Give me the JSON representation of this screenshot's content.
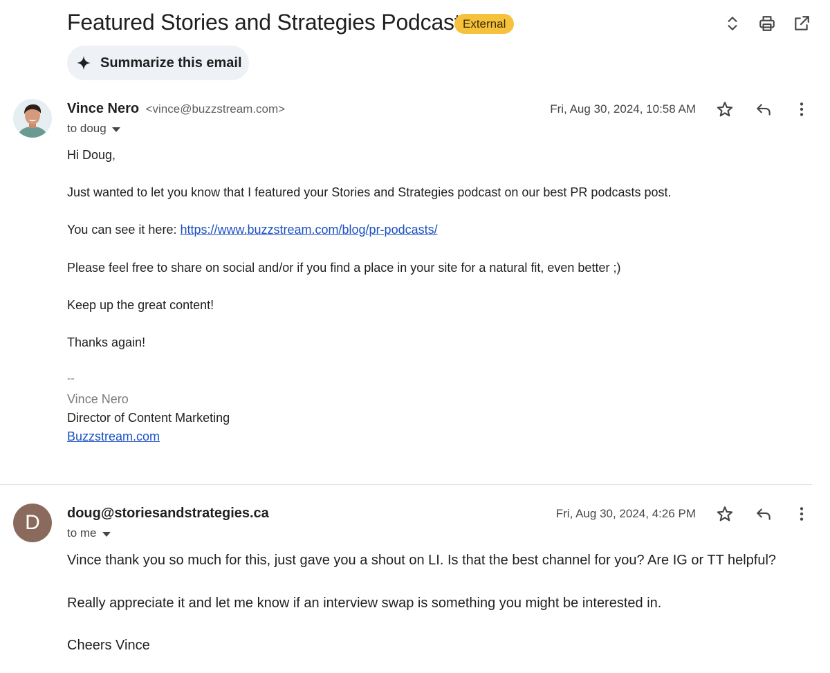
{
  "header": {
    "subject": "Featured Stories and Strategies Podcast",
    "badge": "External",
    "summarize_label": "Summarize this email",
    "icons": [
      "expand-collapse-icon",
      "print-icon",
      "open-in-new-window-icon"
    ]
  },
  "messages": [
    {
      "sender_name": "Vince Nero",
      "sender_email": "<vince@buzzstream.com>",
      "to": "to doug",
      "date": "Fri, Aug 30, 2024, 10:58 AM",
      "body": {
        "greeting": "Hi Doug,",
        "p1": "Just wanted to let you know that I featured your Stories and Strategies podcast on our best PR podcasts post.",
        "p2_prefix": "You can see it here: ",
        "p2_link": "https://www.buzzstream.com/blog/pr-podcasts/",
        "p3": "Please feel free to share on social and/or if you find a place in your site for a natural fit, even better ;)",
        "p4": "Keep up the great content!",
        "p5": "Thanks again!",
        "sig_dash": "--",
        "sig_name": "Vince Nero",
        "sig_title": "Director of Content Marketing",
        "sig_link": "Buzzstream.com"
      }
    },
    {
      "sender_name": "doug@storiesandstrategies.ca",
      "avatar_letter": "D",
      "to": "to me",
      "date": "Fri, Aug 30, 2024, 4:26 PM",
      "body": {
        "p1": "Vince thank you so much for this, just gave you a shout on LI. Is that the best channel for you? Are IG or TT helpful?",
        "p2": "Really appreciate it and let me know if an interview swap is something you might be interested in.",
        "p3": "Cheers Vince"
      }
    }
  ],
  "colors": {
    "badge": "#f6c13c",
    "summarize_bg": "#eef2f7",
    "link": "#1a50c2",
    "avatar_d": "#8b6a5e"
  }
}
